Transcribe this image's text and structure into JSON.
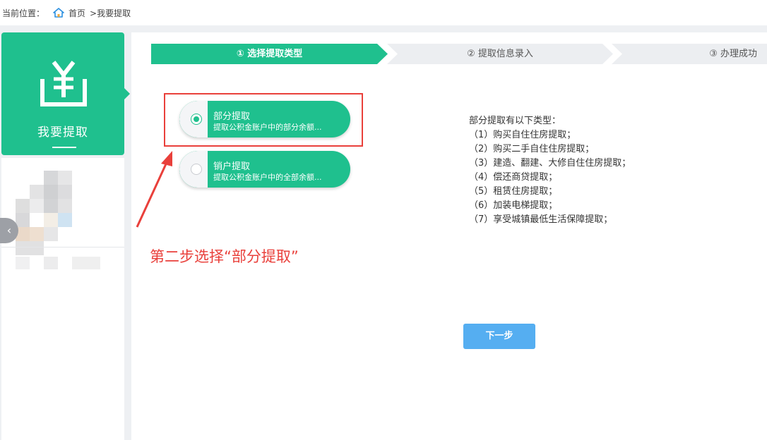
{
  "breadcrumb": {
    "prefix": "当前位置：",
    "home": "首页",
    "current": ">我要提取"
  },
  "sidebar": {
    "card_label": "我要提取",
    "icon": "yen-withdraw-icon",
    "collapse_icon": "chevron-left-icon"
  },
  "steps": [
    {
      "label": "① 选择提取类型"
    },
    {
      "label": "② 提取信息录入"
    },
    {
      "label": "③ 办理成功"
    }
  ],
  "options": [
    {
      "title": "部分提取",
      "subtitle": "提取公积金账户中的部分余额...",
      "selected": true
    },
    {
      "title": "销户提取",
      "subtitle": "提取公积金账户中的全部余额...",
      "selected": false
    }
  ],
  "description": {
    "heading": "部分提取有以下类型：",
    "items": [
      "（1）购买自住住房提取；",
      "（2）购买二手自住住房提取；",
      "（3）建造、翻建、大修自住住房提取；",
      "（4）偿还商贷提取；",
      "（5）租赁住房提取；",
      "（6）加装电梯提取；",
      "（7）享受城镇最低生活保障提取；"
    ]
  },
  "annotation": "第二步选择“部分提取”",
  "next_button": "下一步",
  "colors": {
    "primary": "#1fc08e",
    "annotation": "#e9403b",
    "button": "#55aef1"
  }
}
